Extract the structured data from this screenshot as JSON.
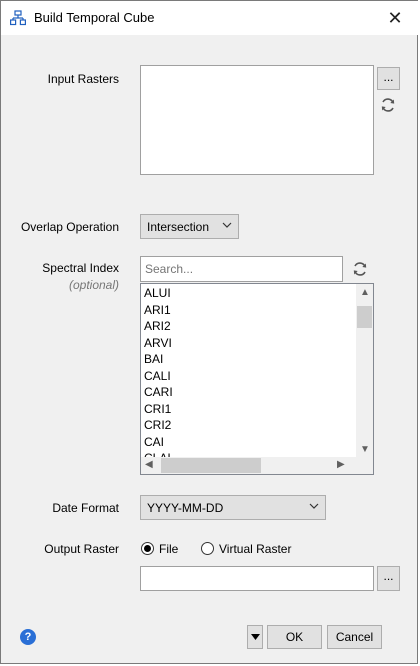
{
  "window": {
    "title": "Build Temporal Cube",
    "close_glyph": "✕"
  },
  "input_rasters": {
    "label": "Input Rasters",
    "browse_label": "..."
  },
  "overlap": {
    "label": "Overlap Operation",
    "value": "Intersection"
  },
  "spectral_index": {
    "label": "Spectral Index",
    "sublabel": "(optional)",
    "search_placeholder": "Search...",
    "items": [
      "ALUI",
      "ARI1",
      "ARI2",
      "ARVI",
      "BAI",
      "CALI",
      "CARI",
      "CRI1",
      "CRI2",
      "CAI",
      "CLAI"
    ]
  },
  "date_format": {
    "label": "Date Format",
    "value": "YYYY-MM-DD"
  },
  "output_raster": {
    "label": "Output Raster",
    "options": [
      "File",
      "Virtual Raster"
    ],
    "selected": "File",
    "path_value": "",
    "browse_label": "..."
  },
  "footer": {
    "help_glyph": "?",
    "ok_label": "OK",
    "cancel_label": "Cancel"
  },
  "icons": {
    "title": "cube-network-icon",
    "refresh": "refresh-icon",
    "dropdown": "chevron-down-icon",
    "help": "help-icon"
  },
  "colors": {
    "accent": "#2a6fd6",
    "window_bg": "#f0f0f0",
    "button_bg": "#e1e1e1"
  }
}
